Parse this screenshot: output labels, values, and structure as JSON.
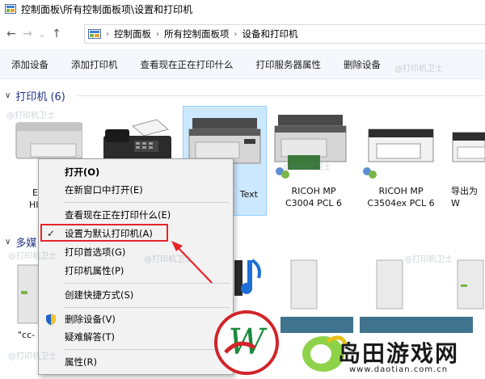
{
  "window": {
    "title": "控制面板\\所有控制面板项\\设置和打印机"
  },
  "nav": {
    "back": "←",
    "forward": "→",
    "dropdown": "⌄",
    "up": "↑"
  },
  "address": {
    "crumbs": [
      "控制面板",
      "所有控制面板项",
      "设备和打印机"
    ],
    "sep": "›"
  },
  "commands": [
    "添加设备",
    "添加打印机",
    "查看现在正在打印什么",
    "打印服务器属性",
    "删除设备"
  ],
  "groups": {
    "printers": {
      "label": "打印机 (6)"
    },
    "media": {
      "label": "多媒"
    }
  },
  "devices": {
    "d1": {
      "line1": "E",
      "line2": "HI"
    },
    "d3": {
      "line1": "Text"
    },
    "d4": {
      "line1": "RICOH MP",
      "line2": "C3004 PCL 6"
    },
    "d5": {
      "line1": "RICOH MP",
      "line2": "C3504ex PCL 6"
    },
    "d6": {
      "line1": "导出为W"
    },
    "m1": {
      "line1": "\"cc-"
    }
  },
  "context_menu": {
    "items": [
      {
        "label": "打开(O)",
        "bold": true
      },
      {
        "label": "在新窗口中打开(E)"
      },
      {
        "label": "查看现在正在打印什么(E)"
      },
      {
        "label": "设置为默认打印机(A)",
        "checked": true
      },
      {
        "label": "打印首选项(G)"
      },
      {
        "label": "打印机属性(P)"
      },
      {
        "label": "创建快捷方式(S)"
      },
      {
        "label": "删除设备(V)",
        "icon": "shield-icon"
      },
      {
        "label": "疑难解答(T)"
      },
      {
        "label": "属性(R)"
      }
    ],
    "check_mark": "✓"
  },
  "watermark": {
    "text": "@打印机卫士"
  },
  "logo": {
    "name": "岛田游戏网",
    "url": "www.daotian.com.cn"
  },
  "colors": {
    "accent": "#1e3287",
    "highlight": "#e8232a",
    "selection": "#cce8ff"
  }
}
